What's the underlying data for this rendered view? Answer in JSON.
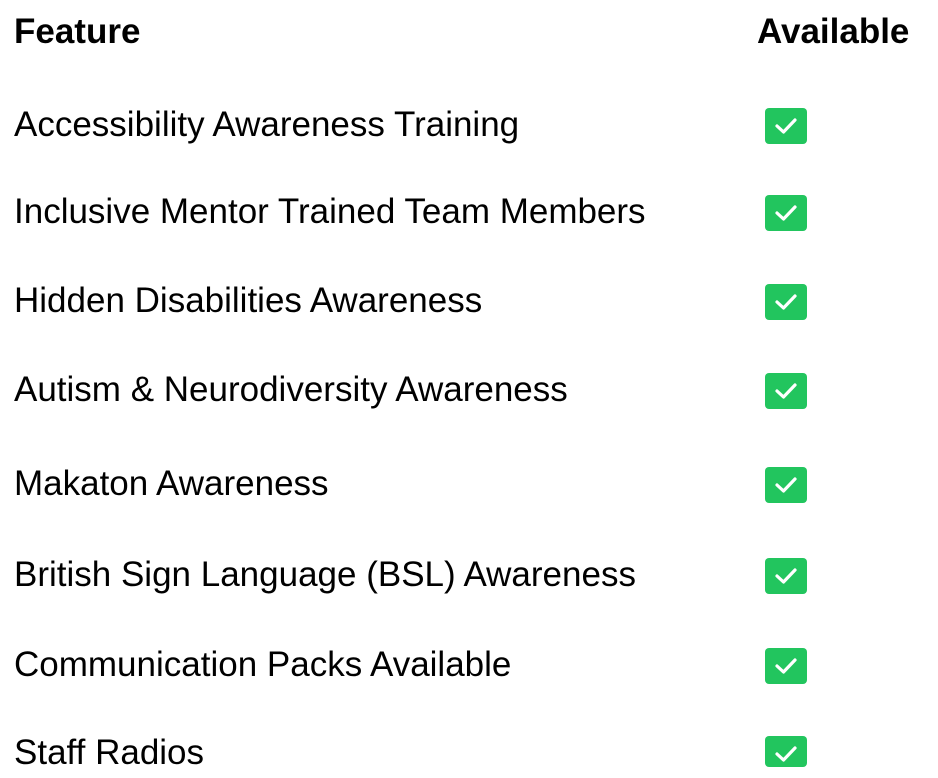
{
  "table": {
    "header": {
      "feature_label": "Feature",
      "available_label": "Available"
    },
    "rows": [
      {
        "label": "Accessibility Awareness Training",
        "available": true
      },
      {
        "label": "Inclusive Mentor Trained Team Members",
        "available": true
      },
      {
        "label": "Hidden Disabilities Awareness",
        "available": true
      },
      {
        "label": "Autism & Neurodiversity Awareness",
        "available": true
      },
      {
        "label": "Makaton Awareness",
        "available": true
      },
      {
        "label": "British Sign Language (BSL) Awareness",
        "available": true
      },
      {
        "label": "Communication Packs Available",
        "available": true
      },
      {
        "label": "Staff Radios",
        "available": true
      }
    ]
  },
  "colors": {
    "check_background": "#22c55e",
    "check_mark": "#ffffff"
  },
  "icons": {
    "available": "check-icon"
  }
}
